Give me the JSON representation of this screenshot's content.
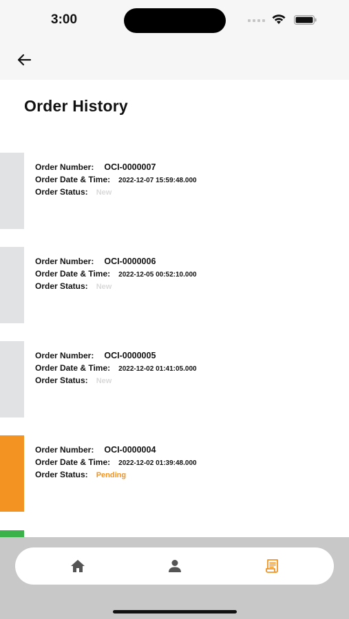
{
  "status_bar": {
    "time": "3:00"
  },
  "nav": {
    "title": ""
  },
  "page": {
    "title": "Order History"
  },
  "labels": {
    "order_number": "Order Number:",
    "order_date": "Order Date & Time:",
    "order_status": "Order Status:"
  },
  "orders": [
    {
      "number": "OCI-0000007",
      "datetime": "2022-12-07 15:59:48.000",
      "status": "New",
      "status_color": "#d9d9d9",
      "stripe_color": "#e1e2e3"
    },
    {
      "number": "OCI-0000006",
      "datetime": "2022-12-05 00:52:10.000",
      "status": "New",
      "status_color": "#d9d9d9",
      "stripe_color": "#e1e2e3"
    },
    {
      "number": "OCI-0000005",
      "datetime": "2022-12-02 01:41:05.000",
      "status": "New",
      "status_color": "#d9d9d9",
      "stripe_color": "#e1e2e3"
    },
    {
      "number": "OCI-0000004",
      "datetime": "2022-12-02 01:39:48.000",
      "status": "Pending",
      "status_color": "#f39422",
      "stripe_color": "#f39422"
    }
  ],
  "partial_card": {
    "stripe_color": "#3cb34a"
  },
  "tabs": [
    {
      "icon": "home-icon",
      "active": false
    },
    {
      "icon": "person-icon",
      "active": false
    },
    {
      "icon": "receipt-icon",
      "active": true
    }
  ],
  "colors": {
    "accent": "#f39422",
    "inactive_icon": "#555555"
  }
}
